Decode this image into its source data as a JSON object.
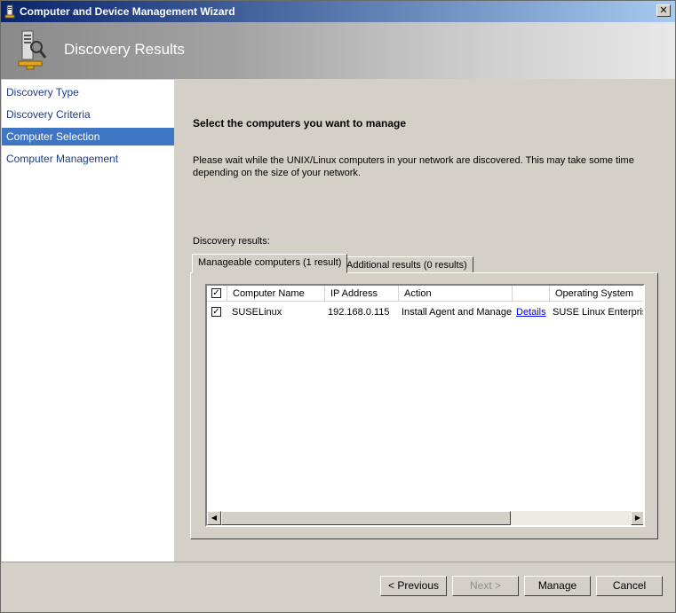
{
  "window": {
    "title": "Computer and Device Management Wizard",
    "close_glyph": "✕",
    "icon": "wizard-app-icon"
  },
  "banner": {
    "title": "Discovery Results",
    "icon": "discovery-server-icon"
  },
  "nav": {
    "items": [
      {
        "label": "Discovery Type",
        "active": false
      },
      {
        "label": "Discovery Criteria",
        "active": false
      },
      {
        "label": "Computer Selection",
        "active": true
      },
      {
        "label": "Computer Management",
        "active": false
      }
    ]
  },
  "main": {
    "heading": "Select the computers you want to manage",
    "description": "Please wait while the UNIX/Linux computers in your network are discovered. This may take some time depending on the size of your network.",
    "results_label": "Discovery results:",
    "tabs": [
      {
        "label": "Manageable computers (1 result)",
        "active": true
      },
      {
        "label": "Additional results (0 results)",
        "active": false
      }
    ],
    "table": {
      "columns": [
        "Computer Name",
        "IP Address",
        "Action",
        "",
        "Operating System"
      ],
      "header_checked": true,
      "rows": [
        {
          "checked": true,
          "computer_name": "SUSELinux",
          "ip_address": "192.168.0.115",
          "action": "Install Agent and Manage",
          "details_link": "Details",
          "operating_system": "SUSE Linux Enterprise"
        }
      ]
    },
    "scroll_left_glyph": "◀",
    "scroll_right_glyph": "▶"
  },
  "buttons": {
    "previous": "< Previous",
    "next": "Next >",
    "manage": "Manage",
    "cancel": "Cancel"
  },
  "colors": {
    "titlebar_start": "#0a246a",
    "titlebar_end": "#a6caf0",
    "nav_active": "#3f76c3",
    "link": "#0000ee"
  }
}
